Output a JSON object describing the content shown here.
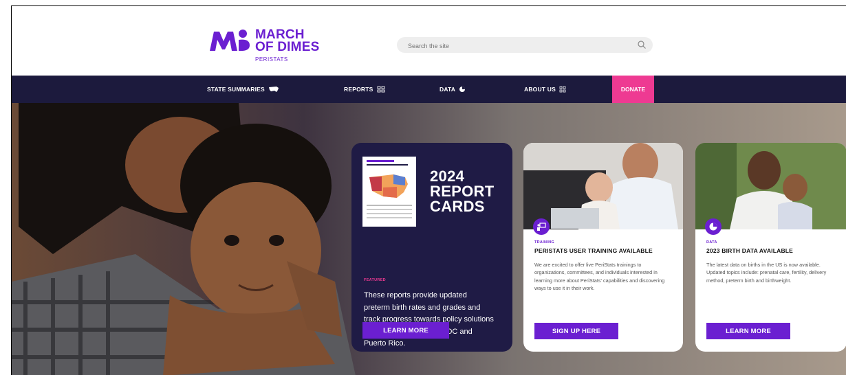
{
  "header": {
    "logo": {
      "line1": "MARCH",
      "line2": "OF DIMES",
      "sub": "PERISTATS",
      "icon": "march-of-dimes-logo-mark"
    },
    "search": {
      "placeholder": "Search the site",
      "icon": "search-icon"
    }
  },
  "nav": {
    "items": [
      {
        "label": "STATE SUMMARIES",
        "icon": "us-map-icon"
      },
      {
        "label": "REPORTS",
        "icon": "reports-icon"
      },
      {
        "label": "DATA",
        "icon": "pie-chart-icon"
      },
      {
        "label": "ABOUT US",
        "icon": "info-icon"
      }
    ],
    "donate_label": "DONATE"
  },
  "colors": {
    "brand_purple": "#6b1fd1",
    "nav_navy": "#1c1a3d",
    "donate_pink": "#ee3a92"
  },
  "cards": {
    "report": {
      "title_line1": "2024",
      "title_line2": "REPORT",
      "title_line3": "CARDS",
      "tag": "FEATURED",
      "text": "These reports provide updated preterm birth rates and grades and track progress towards policy solutions for the US, all 50 states, DC and Puerto Rico.",
      "button": "LEARN MORE"
    },
    "training": {
      "tag": "TRAINING",
      "title": "PERISTATS USER TRAINING AVAILABLE",
      "text": "We are excited to offer live PeriStats trainings to organizations, committees, and individuals interested in learning more about PeriStats' capabilities and discovering ways to use it in their work.",
      "button": "SIGN UP HERE",
      "icon": "presentation-icon"
    },
    "data": {
      "tag": "DATA",
      "title": "2023 BIRTH DATA AVAILABLE",
      "text": "The latest data on births in the US is now available. Updated topics include: prenatal care, fertility, delivery method, preterm birth and birthweight.",
      "button": "LEARN MORE",
      "icon": "pie-chart-icon"
    }
  }
}
